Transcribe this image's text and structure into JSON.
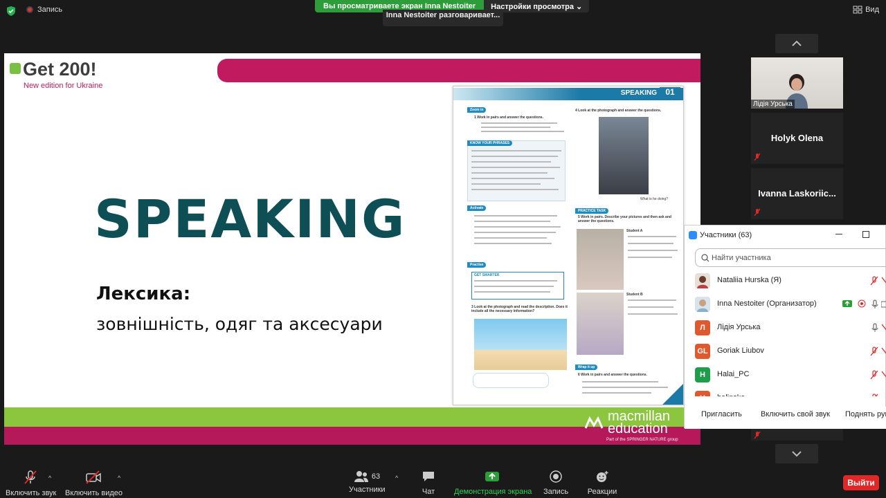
{
  "topbar": {
    "record_label": "Запись",
    "share_banner": "Вы просматриваете экран Inna Nestoiter",
    "view_options": "Настройки просмотра",
    "speaking_indicator": "Inna Nestoiter разговаривает...",
    "view_label": "Вид"
  },
  "slide": {
    "logo_title": "Get 200!",
    "logo_subtitle": "New edition for Ukraine",
    "title": "SPEAKING",
    "lexicon": "Лексика:",
    "subtitle": "зовнішність, одяг та аксесуари",
    "brand_line1": "macmillan",
    "brand_line2": "education",
    "brand_part_of": "Part of the SPRINGER NATURE group",
    "page_header": "SPEAKING",
    "page_number": "01",
    "page_sections": [
      "Zoom in",
      "KNOW YOUR PHRASES",
      "Activate",
      "Practise",
      "PRACTICE TASK",
      "Wrap it up"
    ],
    "page_tasks": [
      "1 Work in pairs and answer the questions.",
      "4 Look at the photograph and answer the questions.",
      "5 Work in pairs. Describe your pictures and then ask and answer the questions.",
      "3 Look at the photograph and read the description. Does it include all the necessary information?",
      "6 Work in pairs and answer the questions."
    ],
    "page_notes": [
      "GET SMARTER",
      "Student A",
      "Student B",
      "What is he doing?"
    ]
  },
  "tiles": [
    {
      "name": "Лідія Урська",
      "type": "camera"
    },
    {
      "name": "Holyk Olena",
      "type": "name"
    },
    {
      "name": "Ivanna  Laskoriic...",
      "type": "name"
    }
  ],
  "participants": {
    "title": "Участники (63)",
    "search_placeholder": "Найти участника",
    "rows": [
      {
        "name": "Nataliia Hurska (Я)",
        "initials": "",
        "color": "#c9b8a8"
      },
      {
        "name": "Inna Nestoiter (Организатор)",
        "initials": "",
        "color": "#a9c4d8"
      },
      {
        "name": "Лідія Урська",
        "initials": "Л",
        "color": "#e0582e"
      },
      {
        "name": "Goriak Liubov",
        "initials": "GL",
        "color": "#e0582e"
      },
      {
        "name": "Halai_PC",
        "initials": "H",
        "color": "#1e9e4b"
      },
      {
        "name": "halinska",
        "initials": "H",
        "color": "#e0582e"
      }
    ],
    "footer": {
      "invite": "Пригласить",
      "unmute_me": "Включить свой звук",
      "raise_hand": "Поднять руку"
    }
  },
  "toolbar": {
    "unmute": "Включить звук",
    "start_video": "Включить видео",
    "participants": "Участники",
    "participants_count": "63",
    "chat": "Чат",
    "share_screen": "Демонстрация экрана",
    "record": "Запись",
    "reactions": "Реакции",
    "leave": "Выйти"
  },
  "colors": {
    "accent_green": "#2d9d3a",
    "leave_red": "#e02828",
    "slide_pink": "#c21a5f",
    "slide_green": "#8cc63f",
    "speaking_teal": "#0e4e55"
  }
}
